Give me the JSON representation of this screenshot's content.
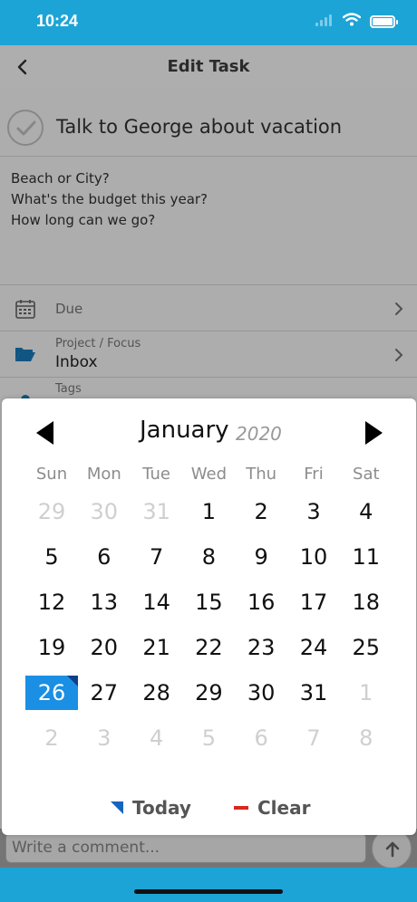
{
  "status_bar": {
    "time": "10:24"
  },
  "nav": {
    "title": "Edit Task"
  },
  "task": {
    "title": "Talk to George about vacation"
  },
  "notes": [
    "Beach or City?",
    "What's the budget this year?",
    "How long can we go?"
  ],
  "fields": {
    "due_label": "Due",
    "project_label": "Project / Focus",
    "project_value": "Inbox",
    "tags_label": "Tags"
  },
  "comment": {
    "placeholder": "Write a comment..."
  },
  "calendar": {
    "month": "January",
    "year": "2020",
    "weekdays": [
      "Sun",
      "Mon",
      "Tue",
      "Wed",
      "Thu",
      "Fri",
      "Sat"
    ],
    "weeks": [
      [
        {
          "d": "29",
          "m": true
        },
        {
          "d": "30",
          "m": true
        },
        {
          "d": "31",
          "m": true
        },
        {
          "d": "1"
        },
        {
          "d": "2"
        },
        {
          "d": "3"
        },
        {
          "d": "4"
        }
      ],
      [
        {
          "d": "5"
        },
        {
          "d": "6"
        },
        {
          "d": "7"
        },
        {
          "d": "8"
        },
        {
          "d": "9"
        },
        {
          "d": "10"
        },
        {
          "d": "11"
        }
      ],
      [
        {
          "d": "12"
        },
        {
          "d": "13"
        },
        {
          "d": "14"
        },
        {
          "d": "15"
        },
        {
          "d": "16"
        },
        {
          "d": "17"
        },
        {
          "d": "18"
        }
      ],
      [
        {
          "d": "19"
        },
        {
          "d": "20"
        },
        {
          "d": "21"
        },
        {
          "d": "22"
        },
        {
          "d": "23"
        },
        {
          "d": "24"
        },
        {
          "d": "25"
        }
      ],
      [
        {
          "d": "26",
          "s": true
        },
        {
          "d": "27"
        },
        {
          "d": "28"
        },
        {
          "d": "29"
        },
        {
          "d": "30"
        },
        {
          "d": "31"
        },
        {
          "d": "1",
          "m": true
        }
      ],
      [
        {
          "d": "2",
          "m": true
        },
        {
          "d": "3",
          "m": true
        },
        {
          "d": "4",
          "m": true
        },
        {
          "d": "5",
          "m": true
        },
        {
          "d": "6",
          "m": true
        },
        {
          "d": "7",
          "m": true
        },
        {
          "d": "8",
          "m": true
        }
      ]
    ],
    "today_label": "Today",
    "clear_label": "Clear"
  },
  "colors": {
    "accent": "#1da4d6",
    "selected": "#1a8fe3",
    "clear": "#d9281d"
  }
}
